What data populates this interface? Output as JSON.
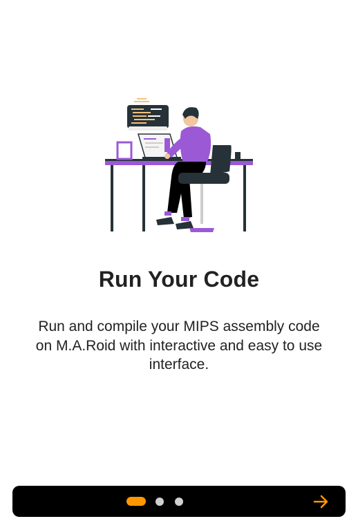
{
  "onboarding": {
    "title": "Run Your Code",
    "description": "Run and compile your MIPS assembly code on M.A.Roid with interactive and easy to use interface.",
    "illustration_icon": "developer-at-desk-illustration",
    "page_indicator": {
      "total": 3,
      "current": 1
    },
    "next_icon": "arrow-right-icon"
  },
  "colors": {
    "accent": "#ff9800",
    "purple": "#9b59d6",
    "bar_background": "#000000",
    "text": "#222222",
    "inactive_dot": "#d0d0d0"
  }
}
